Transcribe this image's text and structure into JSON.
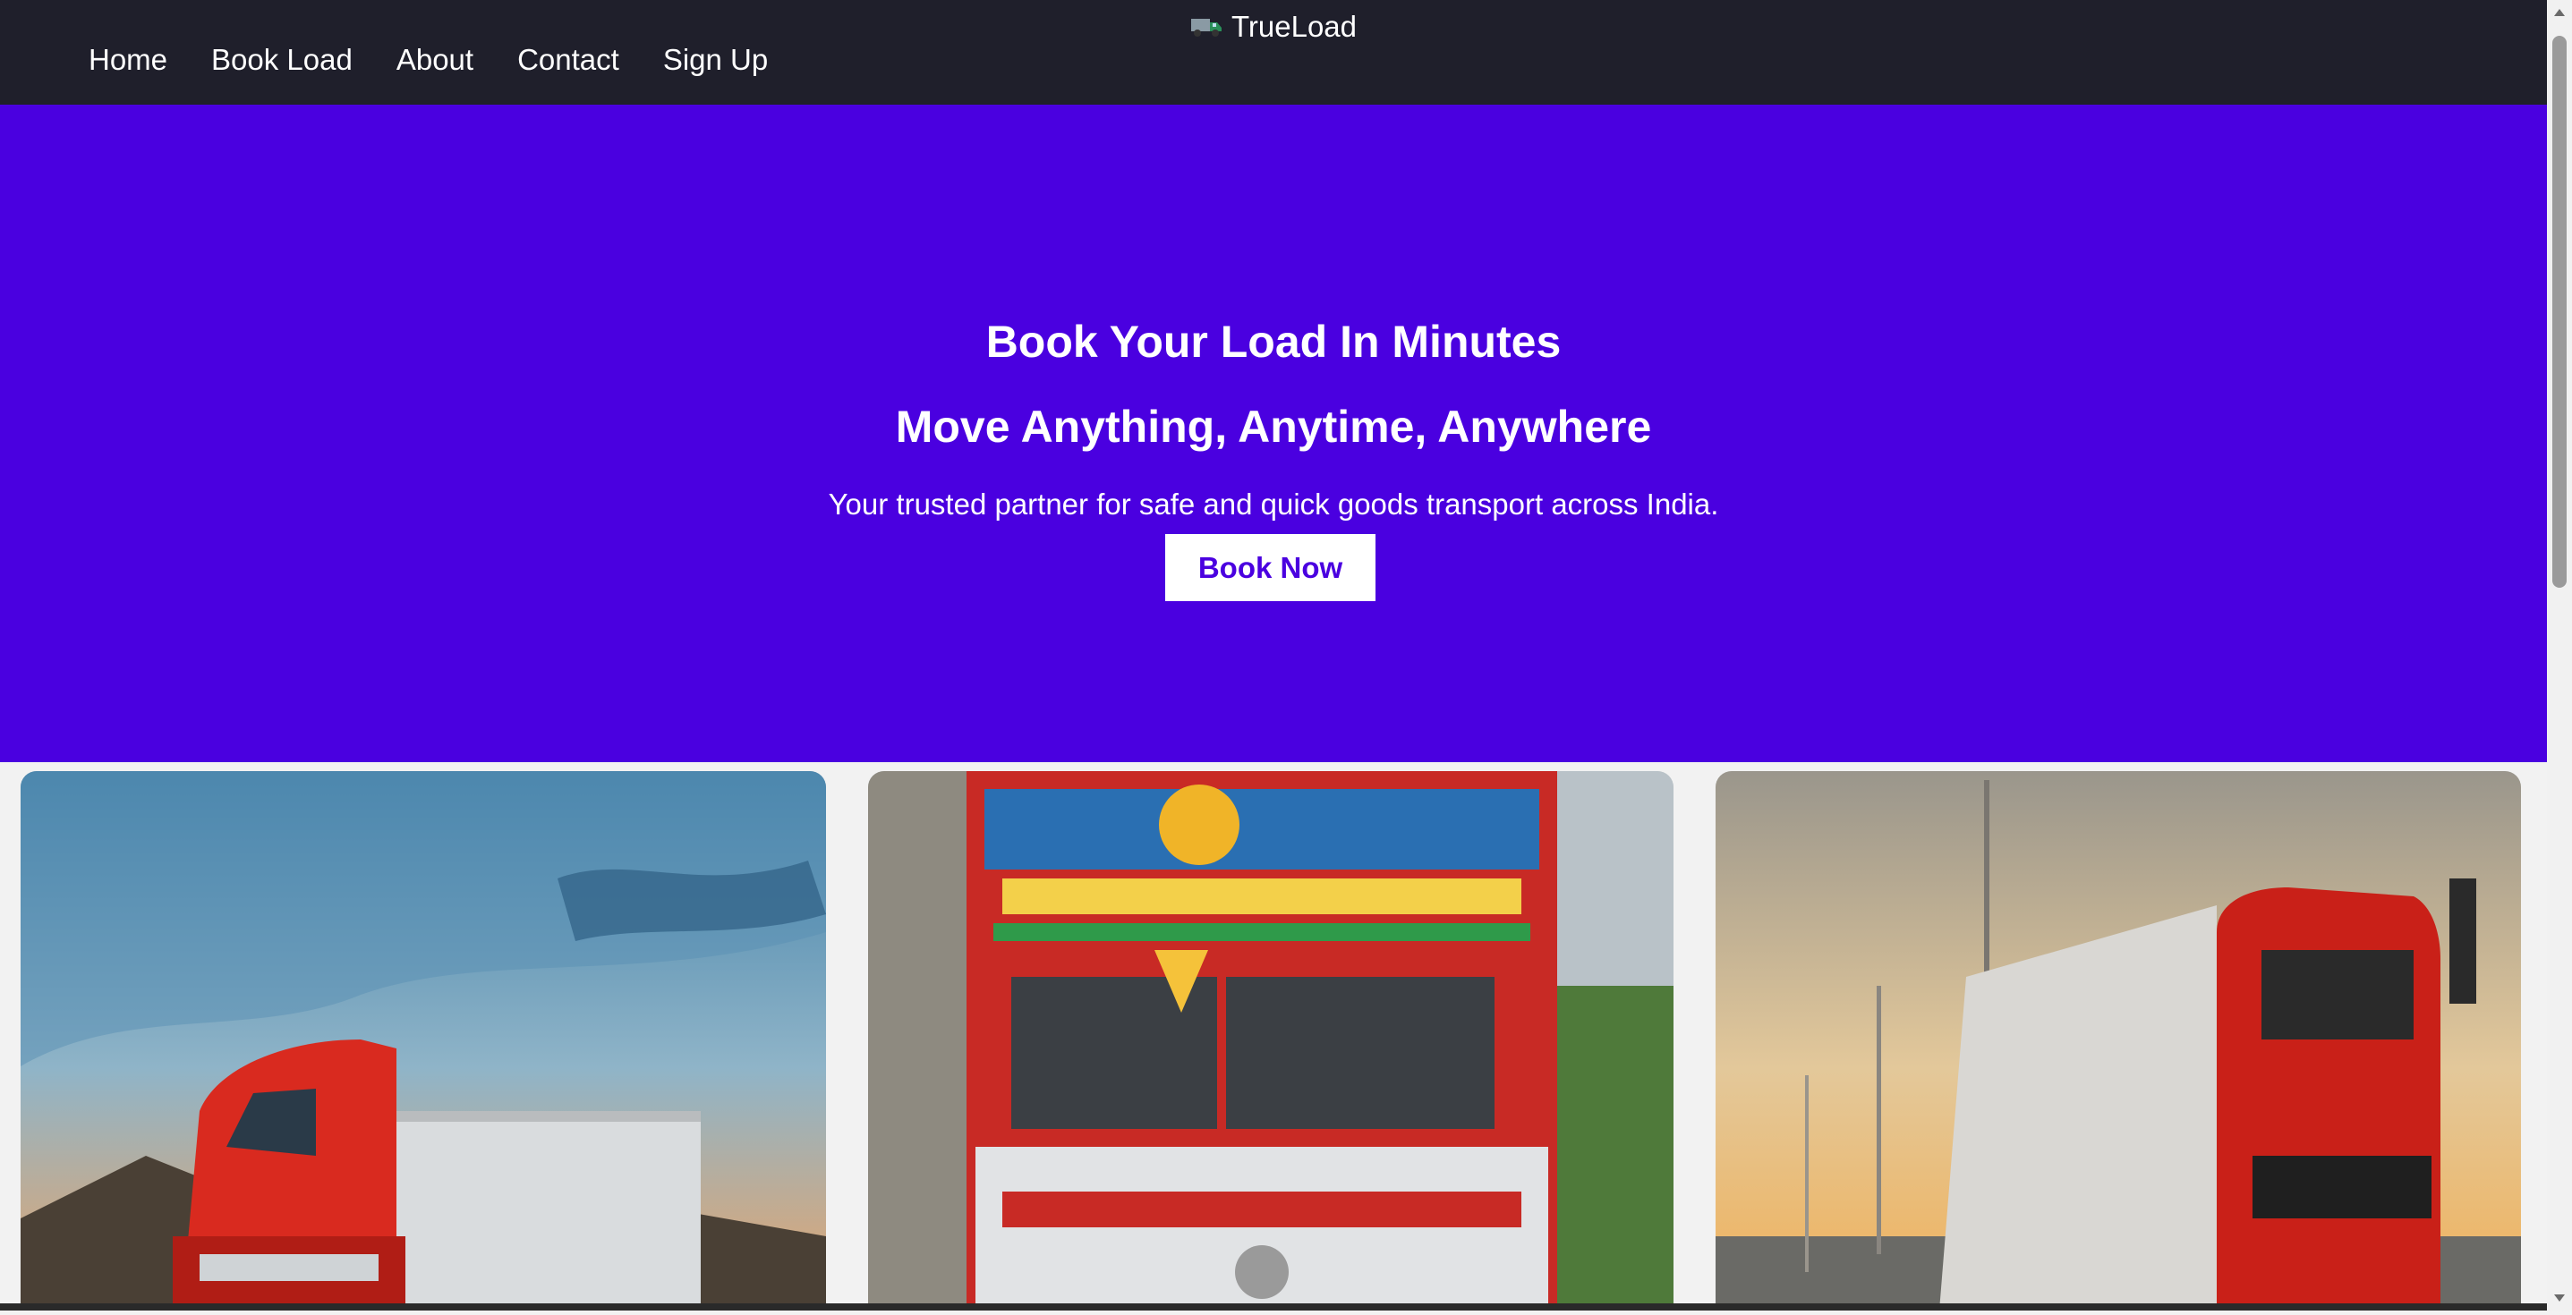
{
  "header": {
    "brand_icon": "truck-icon",
    "brand": "TrueLoad",
    "nav": [
      "Home",
      "Book Load",
      "About",
      "Contact",
      "Sign Up"
    ]
  },
  "hero": {
    "title": "Book Your Load In Minutes",
    "subtitle": "Move Anything, Anytime, Anywhere",
    "tagline": "Your trusted partner for safe and quick goods transport across India.",
    "cta": "Book Now",
    "background": "#4a00e0"
  },
  "cards": [
    {
      "image": "red-semi-truck-desert-sunset"
    },
    {
      "image": "decorated-indian-goods-carrier-truck"
    },
    {
      "image": "red-truck-on-highway-sunset"
    }
  ],
  "colors": {
    "nav_bg": "#1f1f2b",
    "accent": "#4a00e0"
  }
}
